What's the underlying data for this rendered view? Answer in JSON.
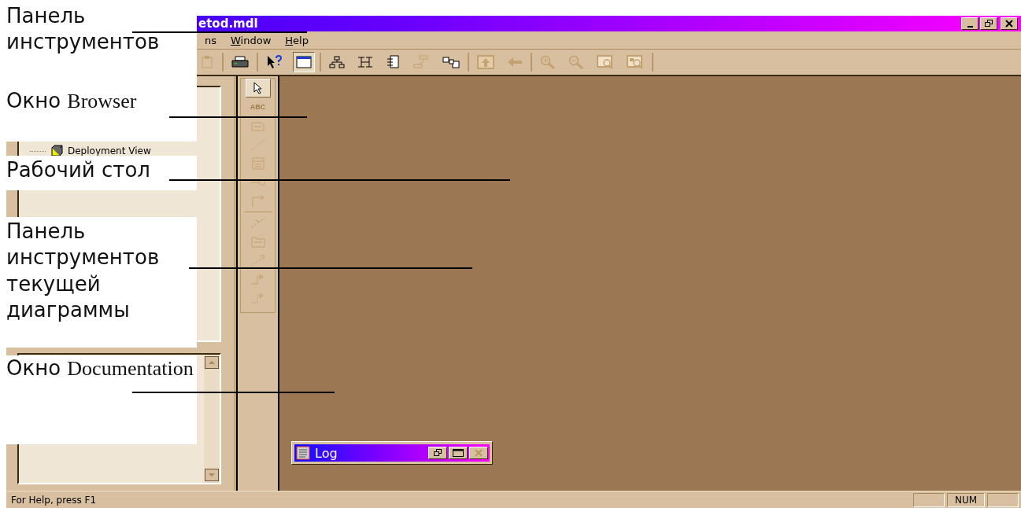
{
  "window": {
    "title": "etod.mdl"
  },
  "menu": [
    {
      "label_rest": "ns"
    },
    {
      "mnemonic": "W",
      "label_rest": "indow"
    },
    {
      "mnemonic": "H",
      "label_rest": "elp"
    }
  ],
  "toolbar": [
    [
      {
        "kind": "paste",
        "disabled": true,
        "pressed": false
      }
    ],
    [
      {
        "kind": "print",
        "disabled": false,
        "pressed": false
      }
    ],
    [
      {
        "kind": "context-help",
        "disabled": false,
        "pressed": false
      },
      {
        "kind": "window",
        "disabled": false,
        "pressed": true
      }
    ],
    [
      {
        "kind": "hierarchy",
        "disabled": false,
        "pressed": false
      },
      {
        "kind": "tree",
        "disabled": false,
        "pressed": false
      },
      {
        "kind": "document",
        "disabled": false,
        "pressed": false
      },
      {
        "kind": "stack",
        "disabled": true,
        "pressed": false
      },
      {
        "kind": "boxes",
        "disabled": false,
        "pressed": false
      }
    ],
    [
      {
        "kind": "up-box",
        "disabled": true,
        "pressed": false
      },
      {
        "kind": "back",
        "disabled": true,
        "pressed": false
      }
    ],
    [
      {
        "kind": "zoom-in",
        "disabled": true,
        "pressed": false
      },
      {
        "kind": "zoom-out",
        "disabled": true,
        "pressed": false
      },
      {
        "kind": "fit",
        "disabled": true,
        "pressed": false
      },
      {
        "kind": "fit-select",
        "disabled": true,
        "pressed": false
      }
    ]
  ],
  "browser": {
    "items": [
      {
        "label": "Deployment View",
        "kind": "deployment"
      }
    ]
  },
  "diagram_tools": [
    [
      {
        "kind": "pointer",
        "selected": true,
        "disabled": false
      },
      {
        "kind": "text",
        "label": "ABC",
        "selected": false,
        "disabled": true
      },
      {
        "kind": "note",
        "selected": false,
        "disabled": true
      },
      {
        "kind": "anchor",
        "selected": false,
        "disabled": true
      },
      {
        "kind": "class",
        "selected": false,
        "disabled": true
      },
      {
        "kind": "interface",
        "selected": false,
        "disabled": true
      },
      {
        "kind": "association",
        "selected": false,
        "disabled": true
      }
    ],
    [
      {
        "kind": "dependency",
        "selected": false,
        "disabled": true
      },
      {
        "kind": "package",
        "selected": false,
        "disabled": true
      },
      {
        "kind": "realize",
        "selected": false,
        "disabled": true
      },
      {
        "kind": "generalize",
        "selected": false,
        "disabled": true
      },
      {
        "kind": "dashed-generalize",
        "selected": false,
        "disabled": true
      }
    ]
  ],
  "log_window": {
    "title": "Log"
  },
  "status_bar": {
    "text": "For Help, press F1",
    "indicators": [
      "NUM"
    ]
  },
  "callouts": [
    {
      "kind": "toolbar",
      "lead": "Панель инструментов"
    },
    {
      "kind": "browser",
      "lead": "Окно",
      "term": "Browser"
    },
    {
      "kind": "desktop",
      "lead": "Рабочий стол"
    },
    {
      "kind": "diagram-toolbar",
      "lead": "Панель инструментов текущей диаграммы"
    },
    {
      "kind": "documentation",
      "lead": "Окно",
      "term": "Documentation"
    }
  ]
}
